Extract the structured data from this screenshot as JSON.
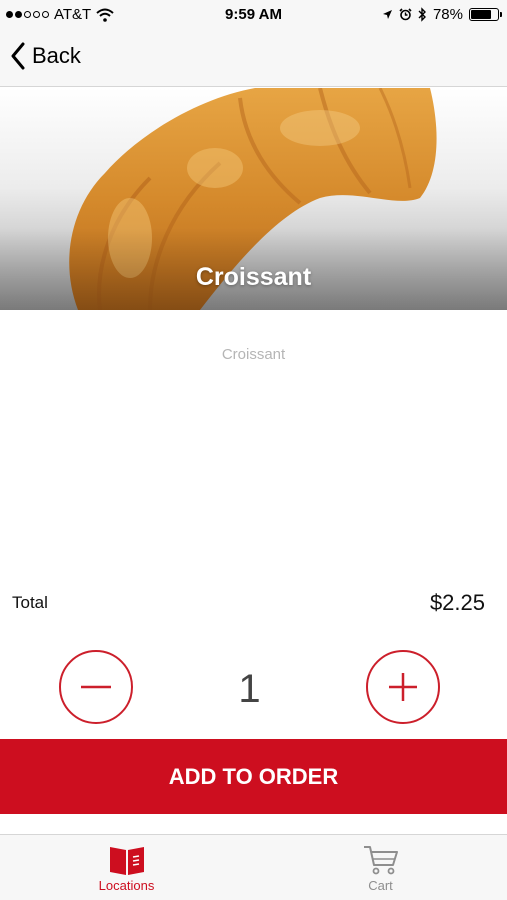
{
  "status_bar": {
    "carrier": "AT&T",
    "time": "9:59 AM",
    "battery": "78%",
    "battery_level": 0.78,
    "signal_bars": 2,
    "signal_total": 5
  },
  "nav": {
    "back_label": "Back"
  },
  "product": {
    "hero_title": "Croissant",
    "description": "Croissant"
  },
  "order": {
    "total_label": "Total",
    "total_value": "$2.25",
    "quantity": "1",
    "add_label": "ADD TO ORDER"
  },
  "tabs": [
    {
      "label": "Locations",
      "icon": "book-icon",
      "active": true
    },
    {
      "label": "Cart",
      "icon": "cart-icon",
      "active": false
    }
  ],
  "colors": {
    "accent": "#cd0e1f",
    "inactive_tab": "#8e8e8e"
  }
}
